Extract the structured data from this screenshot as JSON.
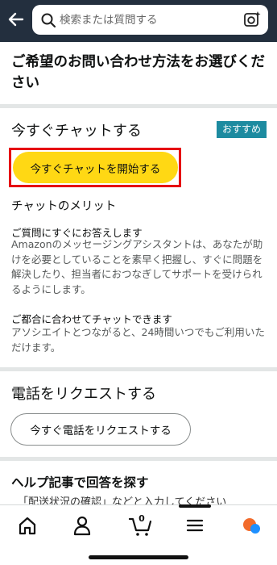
{
  "colors": {
    "header_bg": "#232f3e",
    "cta_yellow": "#ffd814",
    "badge_teal": "#1d8ba0",
    "highlight_red": "#e60012",
    "divider": "#e3e6e6"
  },
  "header": {
    "search_placeholder": "検索または質問する",
    "back_icon": "arrow-left-icon",
    "camera_icon": "camera-sparkle-icon"
  },
  "page_title": "ご希望のお問い合わせ方法をお選びください",
  "chat": {
    "heading": "今すぐチャットする",
    "badge": "おすすめ",
    "start_button": "今すぐチャットを開始する",
    "merit_heading": "チャットのメリット",
    "point1_title": "ご質問にすぐにお答えします",
    "point1_body": "Amazonのメッセージングアシスタントは、あなたが助けを必要としていることを素早く把握し、すぐに問題を解決したり、担当者におつなぎしてサポートを受けられるようにします。",
    "point2_title": "ご都合に合わせてチャットできます",
    "point2_body": "アソシエイトとつながると、24時間いつでもご利用いただけます。"
  },
  "phone": {
    "heading": "電話をリクエストする",
    "button": "今すぐ電話をリクエストする"
  },
  "help": {
    "heading": "ヘルプ記事で回答を探す",
    "text": "「配送状況の確認」などと入力してください"
  },
  "bottom_nav": {
    "items": [
      "home-icon",
      "account-icon",
      "cart-icon",
      "menu-icon",
      "rufus-icon"
    ],
    "cart_count": "0"
  }
}
